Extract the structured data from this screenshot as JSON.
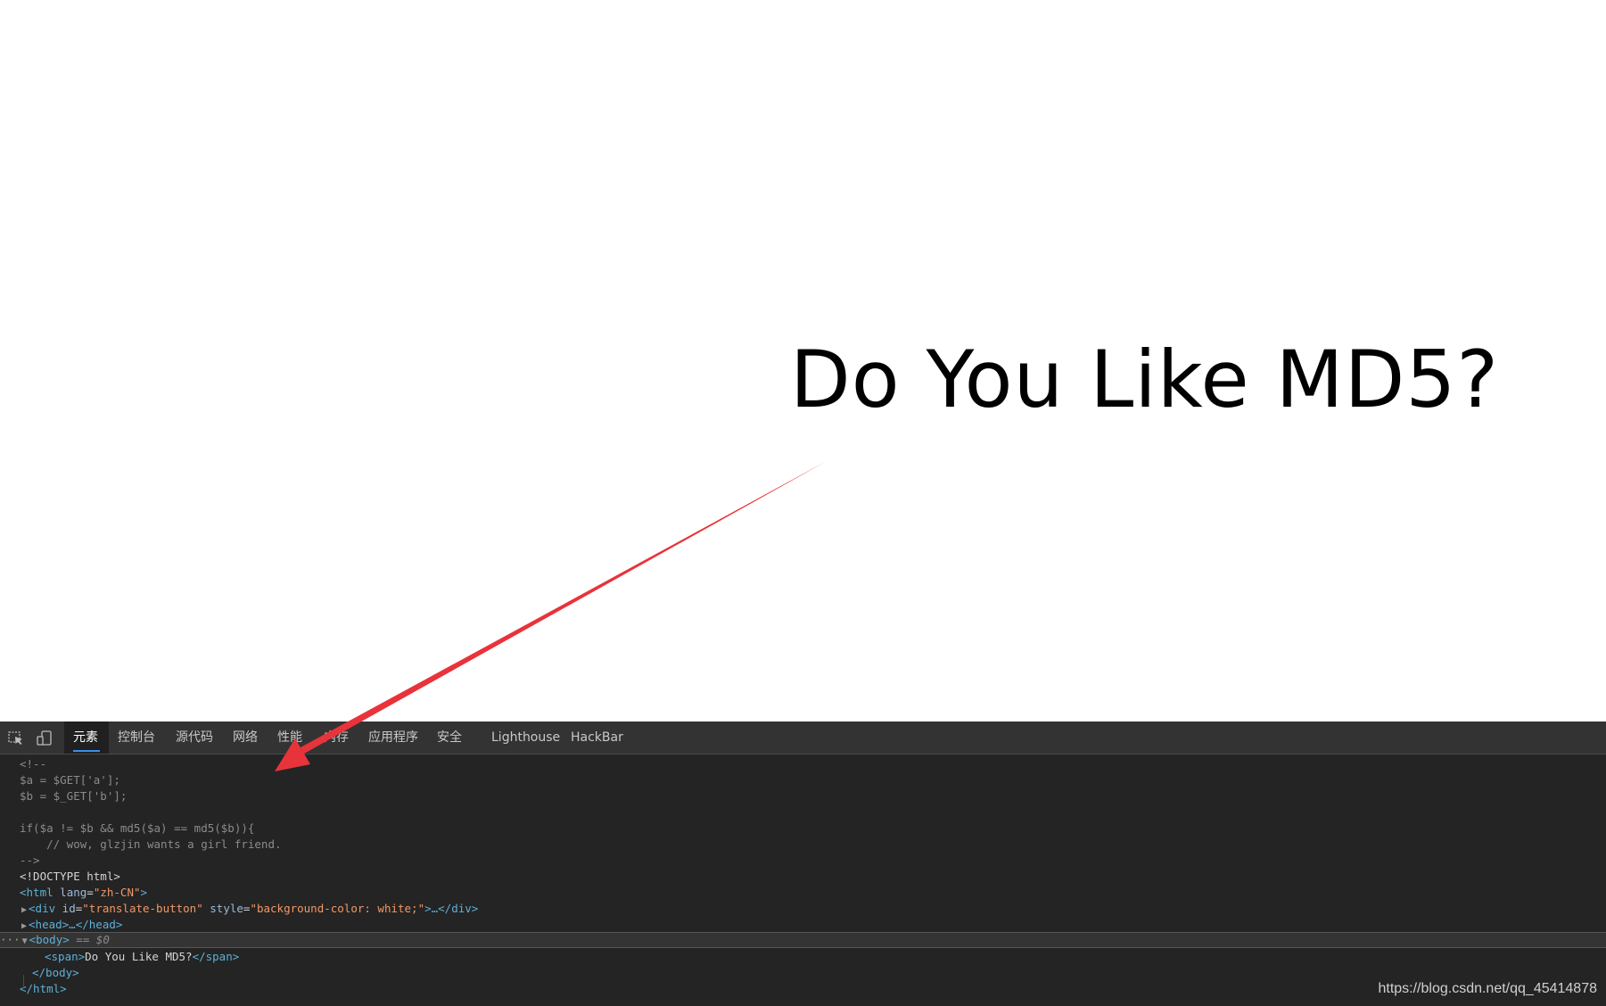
{
  "page": {
    "headline": "Do You Like MD5?"
  },
  "devtools": {
    "tabs": [
      {
        "label": "元素",
        "active": true
      },
      {
        "label": "控制台"
      },
      {
        "label": "源代码"
      },
      {
        "label": "网络"
      },
      {
        "label": "性能"
      },
      {
        "label": "内存"
      },
      {
        "label": "应用程序"
      },
      {
        "label": "安全"
      },
      {
        "label": "Lighthouse"
      },
      {
        "label": "HackBar"
      }
    ],
    "icons": [
      "inspect-element-icon",
      "device-toolbar-icon"
    ],
    "source": {
      "comment_open": "<!--",
      "line_a": "$a = $GET['a'];",
      "line_b": "$b = $_GET['b'];",
      "line_if": "if($a != $b && md5($a) == md5($b)){",
      "line_wow": "    // wow, glzjin wants a girl friend.",
      "comment_close": "-->",
      "doctype": "<!DOCTYPE html>",
      "html_open": {
        "tag": "<html",
        "attr": "lang",
        "val": "\"zh-CN\"",
        "close": ">"
      },
      "div_line": {
        "tag": "<div",
        "attr1": "id",
        "val1": "\"translate-button\"",
        "attr2": "style",
        "val2": "\"background-color: white;\"",
        "rest": ">…</div>"
      },
      "head_line": "<head>…</head>",
      "body_open": "<body>",
      "body_marker": "== $0",
      "span_open": "<span>",
      "span_text": "Do You Like MD5?",
      "span_close": "</span>",
      "body_close": "</body>",
      "html_close": "</html>"
    }
  },
  "watermark": "https://blog.csdn.net/qq_45414878",
  "colors": {
    "devtools_bg": "#242424",
    "tabbar_bg": "#333333",
    "active_tab_underline": "#3b8eea",
    "arrow": "#e8333a"
  }
}
